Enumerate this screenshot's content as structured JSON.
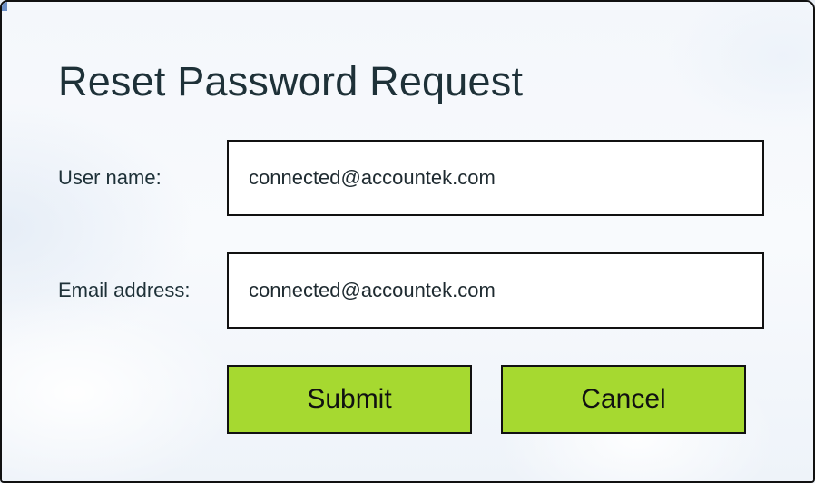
{
  "dialog": {
    "title": "Reset Password Request",
    "fields": {
      "username": {
        "label": "User name:",
        "value": "connected@accountek.com"
      },
      "email": {
        "label": "Email address:",
        "value": "connected@accountek.com"
      }
    },
    "buttons": {
      "submit": "Submit",
      "cancel": "Cancel"
    }
  },
  "colors": {
    "button_bg": "#a6d930",
    "text": "#1e3138",
    "border": "#111111"
  }
}
